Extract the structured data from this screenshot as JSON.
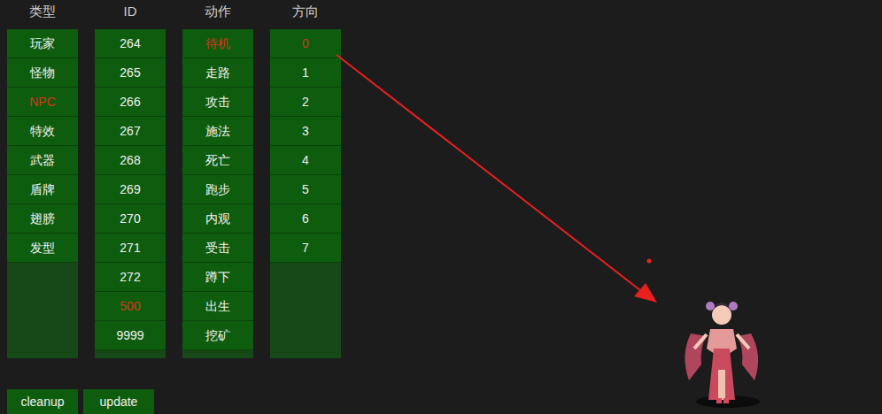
{
  "columns": [
    {
      "header": "类型",
      "items": [
        {
          "label": "玩家",
          "selected": false
        },
        {
          "label": "怪物",
          "selected": false
        },
        {
          "label": "NPC",
          "selected": true
        },
        {
          "label": "特效",
          "selected": false
        },
        {
          "label": "武器",
          "selected": false
        },
        {
          "label": "盾牌",
          "selected": false
        },
        {
          "label": "翅膀",
          "selected": false
        },
        {
          "label": "发型",
          "selected": false
        }
      ]
    },
    {
      "header": "ID",
      "items": [
        {
          "label": "264",
          "selected": false
        },
        {
          "label": "265",
          "selected": false
        },
        {
          "label": "266",
          "selected": false
        },
        {
          "label": "267",
          "selected": false
        },
        {
          "label": "268",
          "selected": false
        },
        {
          "label": "269",
          "selected": false
        },
        {
          "label": "270",
          "selected": false
        },
        {
          "label": "271",
          "selected": false
        },
        {
          "label": "272",
          "selected": false
        },
        {
          "label": "500",
          "selected": true
        },
        {
          "label": "9999",
          "selected": false
        }
      ]
    },
    {
      "header": "动作",
      "items": [
        {
          "label": "待机",
          "selected": true
        },
        {
          "label": "走路",
          "selected": false
        },
        {
          "label": "攻击",
          "selected": false
        },
        {
          "label": "施法",
          "selected": false
        },
        {
          "label": "死亡",
          "selected": false
        },
        {
          "label": "跑步",
          "selected": false
        },
        {
          "label": "内观",
          "selected": false
        },
        {
          "label": "受击",
          "selected": false
        },
        {
          "label": "蹲下",
          "selected": false
        },
        {
          "label": "出生",
          "selected": false
        },
        {
          "label": "挖矿",
          "selected": false
        }
      ]
    },
    {
      "header": "方向",
      "items": [
        {
          "label": "0",
          "selected": true
        },
        {
          "label": "1",
          "selected": false
        },
        {
          "label": "2",
          "selected": false
        },
        {
          "label": "3",
          "selected": false
        },
        {
          "label": "4",
          "selected": false
        },
        {
          "label": "5",
          "selected": false
        },
        {
          "label": "6",
          "selected": false
        },
        {
          "label": "7",
          "selected": false
        }
      ]
    }
  ],
  "buttons": [
    "cleanup",
    "update"
  ]
}
